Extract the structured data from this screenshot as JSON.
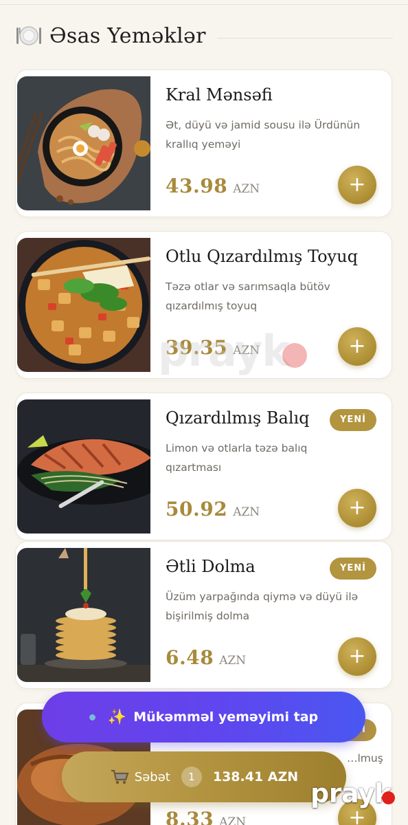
{
  "section": {
    "title": "Əsas Yeməklər",
    "icon": "plate-cutlery-icon"
  },
  "dishes": [
    {
      "name": "Kral Mənsəfi",
      "description": "Ət, düyü və jamid sousu ilə Ürdünün krallıq yeməyi",
      "price": "43.98",
      "currency": "AZN",
      "badge": "",
      "add_label": "+",
      "image": "noodle-bowl-image"
    },
    {
      "name": "Otlu Qızardılmış Toyuq",
      "description": "Təzə otlar və sarımsaqla bütöv qızardılmış toyuq",
      "price": "39.35",
      "currency": "AZN",
      "badge": "",
      "add_label": "+",
      "image": "chicken-stirfry-image"
    },
    {
      "name": "Qızardılmış Balıq",
      "description": "Limon və otlarla təzə balıq qızartması",
      "price": "50.92",
      "currency": "AZN",
      "badge": "YENİ",
      "add_label": "+",
      "image": "grilled-salmon-image"
    },
    {
      "name": "Ətli Dolma",
      "description": "Üzüm yarpağında qiymə və düyü ilə bişirilmiş dolma",
      "price": "6.48",
      "currency": "AZN",
      "badge": "YENİ",
      "add_label": "+",
      "image": "pancake-stack-image"
    },
    {
      "name": "",
      "description": "…lmuş",
      "price": "8.33",
      "currency": "AZN",
      "badge": "YENİ",
      "add_label": "+",
      "image": "roast-chicken-image"
    }
  ],
  "cta": {
    "sparkle": "✨",
    "label": "Mükəmməl yeməyimi tap"
  },
  "cart": {
    "label": "Səbət",
    "count": "1",
    "total": "138.41 AZN"
  },
  "watermark": {
    "text": "prayk"
  },
  "colors": {
    "accent_gold": "#b3943f",
    "price_gold": "#a88a3c",
    "cta_purple": "#5f46ee",
    "background": "#f8f5ee"
  }
}
